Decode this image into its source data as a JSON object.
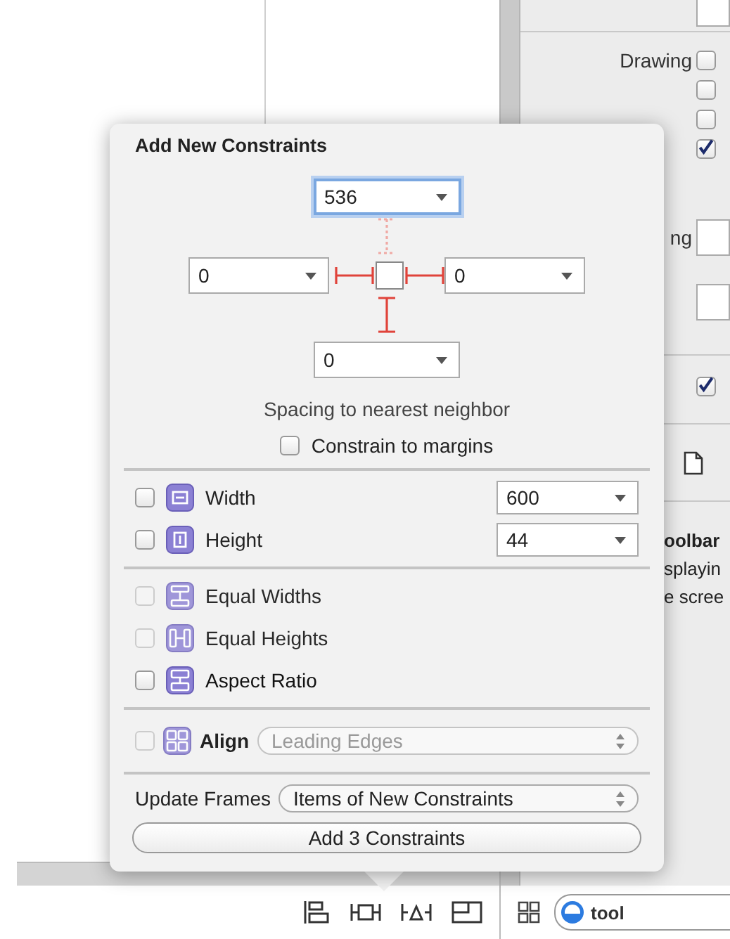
{
  "inspector": {
    "drawing_label": "Drawing",
    "drawing_checkboxes": [
      {
        "checked": false
      },
      {
        "checked": false
      },
      {
        "checked": false
      },
      {
        "checked": true
      }
    ],
    "spacing_label": "ng",
    "option_checkbox": {
      "checked": true
    },
    "description_title": "oolbar",
    "description_lines": [
      "splayin",
      "e scree"
    ]
  },
  "popover": {
    "title": "Add New Constraints",
    "spacing": {
      "top": {
        "value": "536",
        "focused": true,
        "pinned": false
      },
      "left": {
        "value": "0",
        "focused": false,
        "pinned": true
      },
      "right": {
        "value": "0",
        "focused": false,
        "pinned": true
      },
      "bottom": {
        "value": "0",
        "focused": false,
        "pinned": true
      }
    },
    "spacing_caption": "Spacing to nearest neighbor",
    "constrain_to_margins": {
      "label": "Constrain to margins",
      "checked": false
    },
    "size_constraints": [
      {
        "kind": "width",
        "label": "Width",
        "checked": false,
        "value": "600"
      },
      {
        "kind": "height",
        "label": "Height",
        "checked": false,
        "value": "44"
      }
    ],
    "equality_constraints": [
      {
        "kind": "equal-widths",
        "label": "Equal Widths",
        "checked": false,
        "disabled": true
      },
      {
        "kind": "equal-heights",
        "label": "Equal Heights",
        "checked": false,
        "disabled": true
      },
      {
        "kind": "aspect-ratio",
        "label": "Aspect Ratio",
        "checked": false,
        "disabled": false
      }
    ],
    "align": {
      "label": "Align",
      "checked": false,
      "disabled": true,
      "value": "Leading Edges"
    },
    "update_frames": {
      "label": "Update Frames",
      "value": "Items of New Constraints"
    },
    "add_button": "Add 3 Constraints"
  },
  "search": {
    "value": "tool"
  }
}
